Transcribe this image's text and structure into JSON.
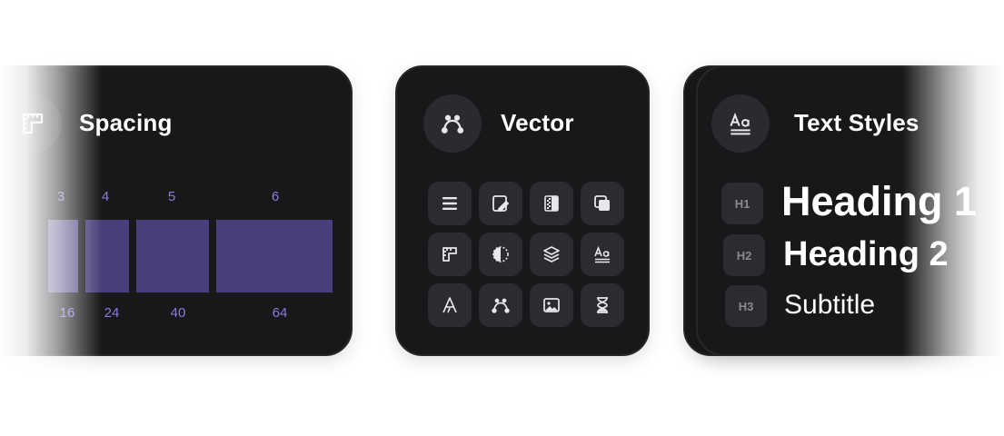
{
  "cards": {
    "spacing": {
      "title": "Spacing",
      "icon": "ruler-icon",
      "steps": [
        {
          "top": "3",
          "bottom": "16"
        },
        {
          "top": "4",
          "bottom": "24"
        },
        {
          "top": "5",
          "bottom": "40"
        },
        {
          "top": "6",
          "bottom": "64"
        }
      ]
    },
    "vector": {
      "title": "Vector",
      "icon": "bezier-curve-icon",
      "grid_icons": [
        "align-justify-icon",
        "edit-fill-icon",
        "gradient-icon",
        "layer-overlap-icon",
        "ruler-icon",
        "contrast-icon",
        "layers-icon",
        "text-style-icon",
        "font-icon",
        "bezier-curve-icon",
        "image-icon",
        "hourglass-icon"
      ]
    },
    "text_styles": {
      "title": "Text Styles",
      "icon": "text-style-icon",
      "rows": [
        {
          "badge": "H1",
          "label": "Heading 1"
        },
        {
          "badge": "H2",
          "label": "Heading 2"
        },
        {
          "badge": "H3",
          "label": "Subtitle"
        }
      ]
    }
  },
  "colors": {
    "card_bg": "#17181a",
    "accent_purple": "#8b7bdb",
    "bar_purple": "#493f7a"
  }
}
